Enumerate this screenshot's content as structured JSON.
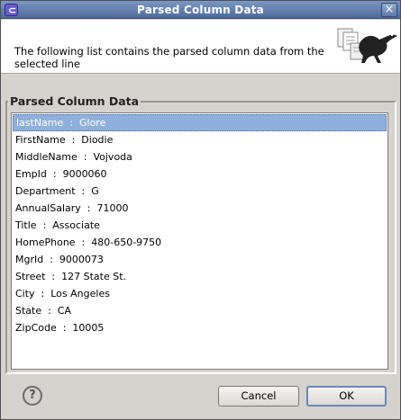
{
  "window": {
    "title": "Parsed Column Data"
  },
  "header": {
    "description": "The following list contains the parsed column data from the selected line"
  },
  "group": {
    "label": "Parsed Column Data"
  },
  "list": {
    "items": [
      {
        "label": "lastName  :  Glore",
        "selected": true
      },
      {
        "label": "FirstName  :  Diodie"
      },
      {
        "label": "MiddleName  :  Vojvoda"
      },
      {
        "label": "EmpId  :  9000060"
      },
      {
        "label": "Department  :  G"
      },
      {
        "label": "AnnualSalary  :  71000"
      },
      {
        "label": "Title  :  Associate"
      },
      {
        "label": "HomePhone  :  480-650-9750"
      },
      {
        "label": "MgrId  :  9000073"
      },
      {
        "label": "Street  :  127 State St."
      },
      {
        "label": "City  :  Los Angeles"
      },
      {
        "label": "State  :  CA"
      },
      {
        "label": "ZipCode  :  10005"
      }
    ]
  },
  "footer": {
    "cancel_label": "Cancel",
    "ok_label": "OK",
    "help_icon": "?"
  },
  "titlebar": {
    "close_glyph": "×",
    "app_icon_glyph": "⊂"
  },
  "colors": {
    "selection": "#8fb0dc",
    "titlebar": "#4d6a9a"
  }
}
